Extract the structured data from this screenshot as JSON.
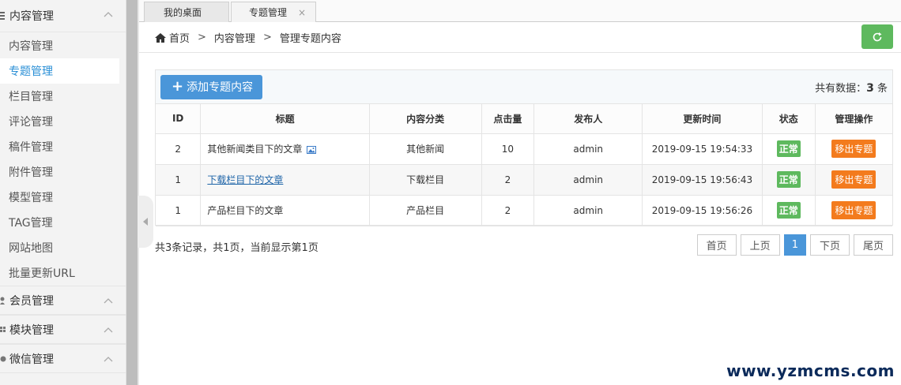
{
  "sidebar": {
    "groups": [
      {
        "label": "内容管理"
      },
      {
        "label": "会员管理"
      },
      {
        "label": "模块管理"
      },
      {
        "label": "微信管理"
      }
    ],
    "items": [
      {
        "label": "内容管理"
      },
      {
        "label": "专题管理"
      },
      {
        "label": "栏目管理"
      },
      {
        "label": "评论管理"
      },
      {
        "label": "稿件管理"
      },
      {
        "label": "附件管理"
      },
      {
        "label": "模型管理"
      },
      {
        "label": "TAG管理"
      },
      {
        "label": "网站地图"
      },
      {
        "label": "批量更新URL"
      }
    ]
  },
  "tabs": [
    {
      "label": "我的桌面"
    },
    {
      "label": "专题管理",
      "close": "×"
    }
  ],
  "breadcrumb": {
    "home": "首页",
    "sep": ">",
    "level1": "内容管理",
    "level2": "管理专题内容"
  },
  "panel": {
    "add_label": "添加专题内容",
    "total_prefix": "共有数据：",
    "total_count": "3",
    "total_suffix": " 条"
  },
  "table": {
    "headers": [
      "ID",
      "标题",
      "内容分类",
      "点击量",
      "发布人",
      "更新时间",
      "状态",
      "管理操作"
    ],
    "rows": [
      {
        "id": "2",
        "title": "其他新闻类目下的文章",
        "category": "其他新闻",
        "hits": "10",
        "author": "admin",
        "updated": "2019-09-15 19:54:33",
        "status": "正常",
        "action": "移出专题"
      },
      {
        "id": "1",
        "title": "下载栏目下的文章",
        "category": "下载栏目",
        "hits": "2",
        "author": "admin",
        "updated": "2019-09-15 19:56:43",
        "status": "正常",
        "action": "移出专题"
      },
      {
        "id": "1",
        "title": "产品栏目下的文章",
        "category": "产品栏目",
        "hits": "2",
        "author": "admin",
        "updated": "2019-09-15 19:56:26",
        "status": "正常",
        "action": "移出专题"
      }
    ]
  },
  "footer": {
    "records": "共3条记录，共1页，当前显示第1页",
    "pager": {
      "first": "首页",
      "prev": "上页",
      "current": "1",
      "next": "下页",
      "last": "尾页"
    }
  },
  "watermark": "www.yzmcms.com",
  "colors": {
    "accent": "#4a96d9",
    "success": "#5eb95e",
    "warning": "#f37b1d",
    "active_link": "#2a8fd6"
  }
}
